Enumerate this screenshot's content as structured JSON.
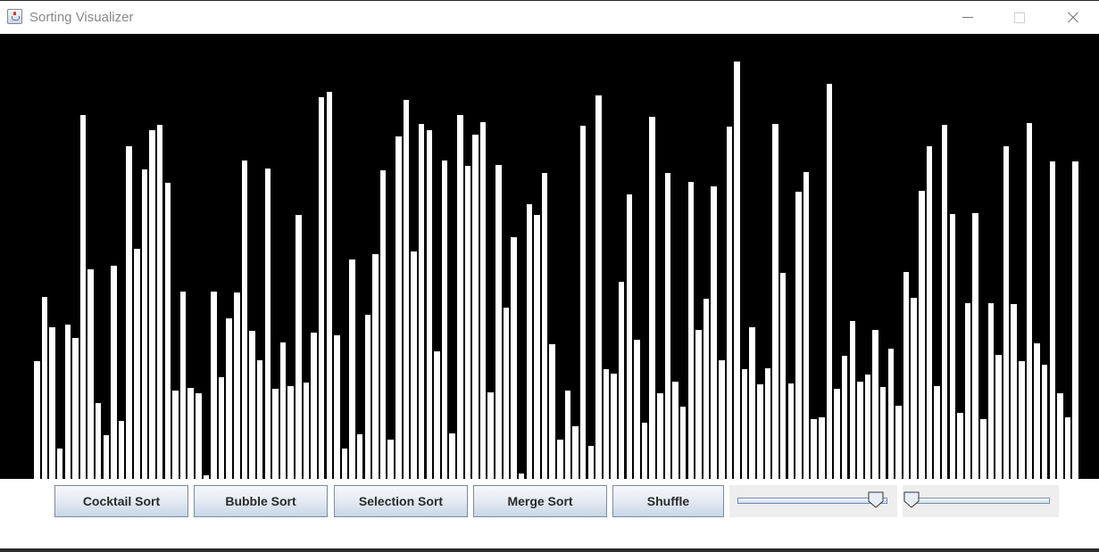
{
  "window": {
    "title": "Sorting Visualizer",
    "icon": "java-cup-icon",
    "controls": [
      "minimize",
      "maximize",
      "close"
    ]
  },
  "visualizer": {
    "background_color": "#000000",
    "bar_color": "#ffffff",
    "max_value": 468,
    "values": [
      142,
      220,
      183,
      37,
      187,
      170,
      440,
      254,
      92,
      53,
      258,
      70,
      402,
      278,
      374,
      422,
      428,
      358,
      107,
      227,
      110,
      104,
      4,
      227,
      123,
      194,
      225,
      385,
      179,
      144,
      375,
      109,
      165,
      112,
      319,
      117,
      177,
      462,
      468,
      174,
      37,
      265,
      54,
      199,
      272,
      373,
      48,
      414,
      459,
      275,
      430,
      422,
      154,
      385,
      55,
      440,
      379,
      417,
      432,
      105,
      380,
      207,
      292,
      7,
      332,
      319,
      370,
      163,
      48,
      107,
      64,
      427,
      40,
      464,
      133,
      127,
      238,
      344,
      168,
      68,
      438,
      104,
      370,
      118,
      87,
      359,
      180,
      218,
      354,
      143,
      426,
      505,
      133,
      183,
      114,
      134,
      430,
      249,
      115,
      347,
      371,
      72,
      74,
      478,
      109,
      149,
      191,
      118,
      126,
      180,
      111,
      158,
      89,
      250,
      219,
      349,
      402,
      112,
      428,
      320,
      80,
      213,
      322,
      72,
      213,
      150,
      402,
      212,
      142,
      431,
      164,
      138,
      384,
      104,
      74,
      384
    ],
    "note": "Bar heights in pixels relative to max bar height; bars drawn left-to-right"
  },
  "controls": {
    "buttons": [
      {
        "id": "cocktail",
        "label": "Cocktail Sort"
      },
      {
        "id": "bubble",
        "label": "Bubble Sort"
      },
      {
        "id": "selection",
        "label": "Selection Sort"
      },
      {
        "id": "merge",
        "label": "Merge Sort"
      },
      {
        "id": "shuffle",
        "label": "Shuffle"
      }
    ],
    "sliders": [
      {
        "id": "array-size-slider",
        "value_fraction": 0.97
      },
      {
        "id": "speed-slider",
        "value_fraction": 0.0
      }
    ]
  }
}
